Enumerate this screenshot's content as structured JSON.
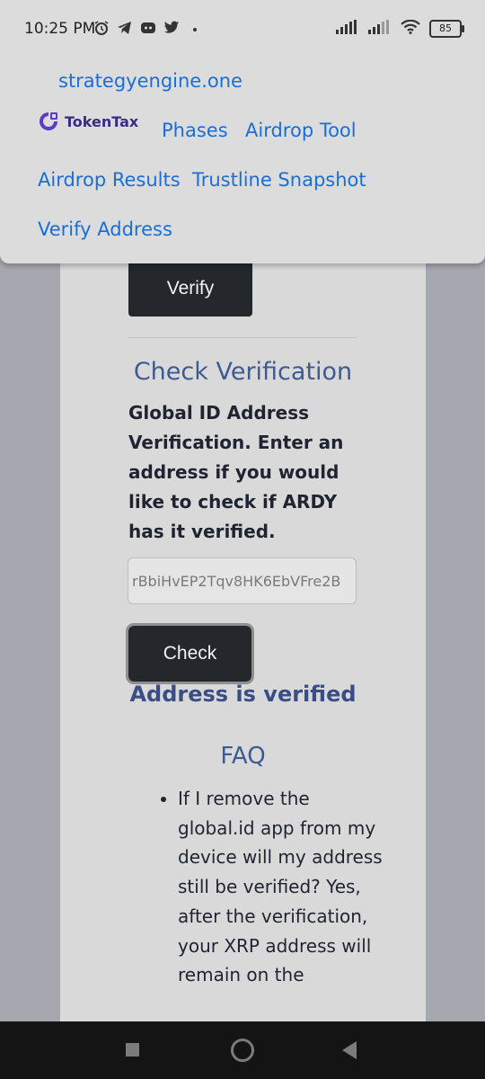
{
  "status_bar": {
    "time": "10:25 PM",
    "battery": "85",
    "left_icons": [
      "alarm-icon",
      "telegram-icon",
      "discord-icon",
      "twitter-icon",
      "dot-icon"
    ],
    "right_icons": [
      "signal-icon",
      "signal-2-icon",
      "wifi-icon",
      "battery-icon"
    ]
  },
  "nav": {
    "site_link": "strategyengine.one",
    "logo_text": "TokenTax",
    "links": [
      "Phases",
      "Airdrop Tool",
      "Airdrop Results",
      "Trustline Snapshot",
      "Verify Address"
    ]
  },
  "verify_section": {
    "button": "Verify"
  },
  "check_section": {
    "title": "Check Verification",
    "description": "Global ID Address Verification. Enter an address if you would like to check if ARDY has it verified.",
    "input_value": "rBbiHvEP2Tqv8HK6EbVFre2B",
    "button": "Check",
    "result": "Address is verified"
  },
  "faq": {
    "title": "FAQ",
    "items": [
      "If I remove the global.id app from my device will my address still be verified? Yes, after the verification, your XRP address will remain on the"
    ]
  },
  "colors": {
    "link": "#1a6ed8",
    "heading": "#3e5a93",
    "button_bg": "#24282c"
  }
}
